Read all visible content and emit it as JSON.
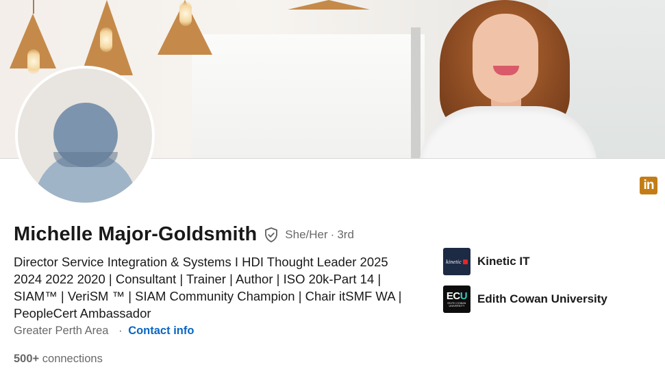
{
  "profile": {
    "name": "Michelle Major-Goldsmith",
    "pronouns": "She/Her",
    "separator": "·",
    "degree": "3rd",
    "headline_lines": [
      "Director Service Integration & Systems I HDI Thought Leader 2025",
      "2024 2022 2020 | Consultant | Trainer | Author | ISO 20k-Part 14 |",
      "SIAM™ | VeriSM ™ | SIAM Community Champion | Chair itSMF WA |",
      "PeopleCert Ambassador"
    ],
    "location": "Greater Perth Area",
    "location_separator": "·",
    "contact_info_label": "Contact info",
    "connections_count": "500+",
    "connections_label": "connections"
  },
  "companies": [
    {
      "name": "Kinetic IT",
      "logo_text": "kinetic",
      "logo_color": "#1d2a44",
      "logo_accent": "#e3262a"
    },
    {
      "name": "Edith Cowan University",
      "logo_text": "ECU",
      "logo_subtext": "EDITH COWAN UNIVERSITY",
      "logo_color": "#0d0d0d",
      "logo_accent": "#3cc6c0"
    }
  ],
  "icons": {
    "linkedin": "linkedin-icon",
    "verified": "verified-shield-icon",
    "avatar": "default-avatar-icon"
  },
  "colors": {
    "link": "#0a66c2",
    "linkedin_badge": "#c37d16",
    "secondary_text": "rgba(0,0,0,0.6)"
  }
}
